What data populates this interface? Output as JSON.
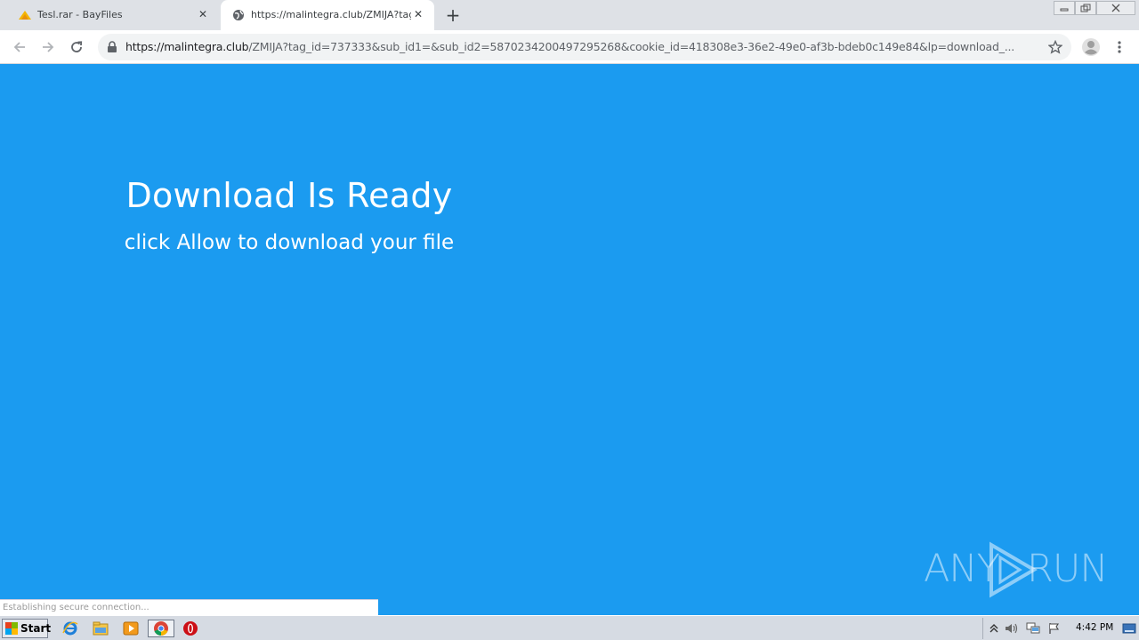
{
  "browser": {
    "tabs": [
      {
        "title": "Tesl.rar - BayFiles",
        "icon": "bayfiles-icon",
        "active": false
      },
      {
        "title": "https://malintegra.club/ZMIJA?tag_i",
        "icon": "globe-icon",
        "active": true
      }
    ],
    "new_tab_label": "+",
    "address_bar": {
      "host": "https://malintegra.club",
      "path": "/ZMIJA?tag_id=737333&sub_id1=&sub_id2=5870234200497295268&cookie_id=418308e3-36e2-49e0-af3b-bdeb0c149e84&lp=download_...",
      "secure_icon": "lock-icon"
    }
  },
  "page": {
    "heading": "Download Is Ready",
    "subheading": "click Allow to download your file",
    "background_color": "#1b9bf0",
    "status_text": "Establishing secure connection...",
    "watermark_left": "ANY",
    "watermark_right": "RUN"
  },
  "taskbar": {
    "start_label": "Start",
    "pinned": [
      "ie-icon",
      "explorer-icon",
      "media-player-icon",
      "chrome-icon",
      "opera-icon"
    ],
    "clock": "4:42 PM"
  }
}
